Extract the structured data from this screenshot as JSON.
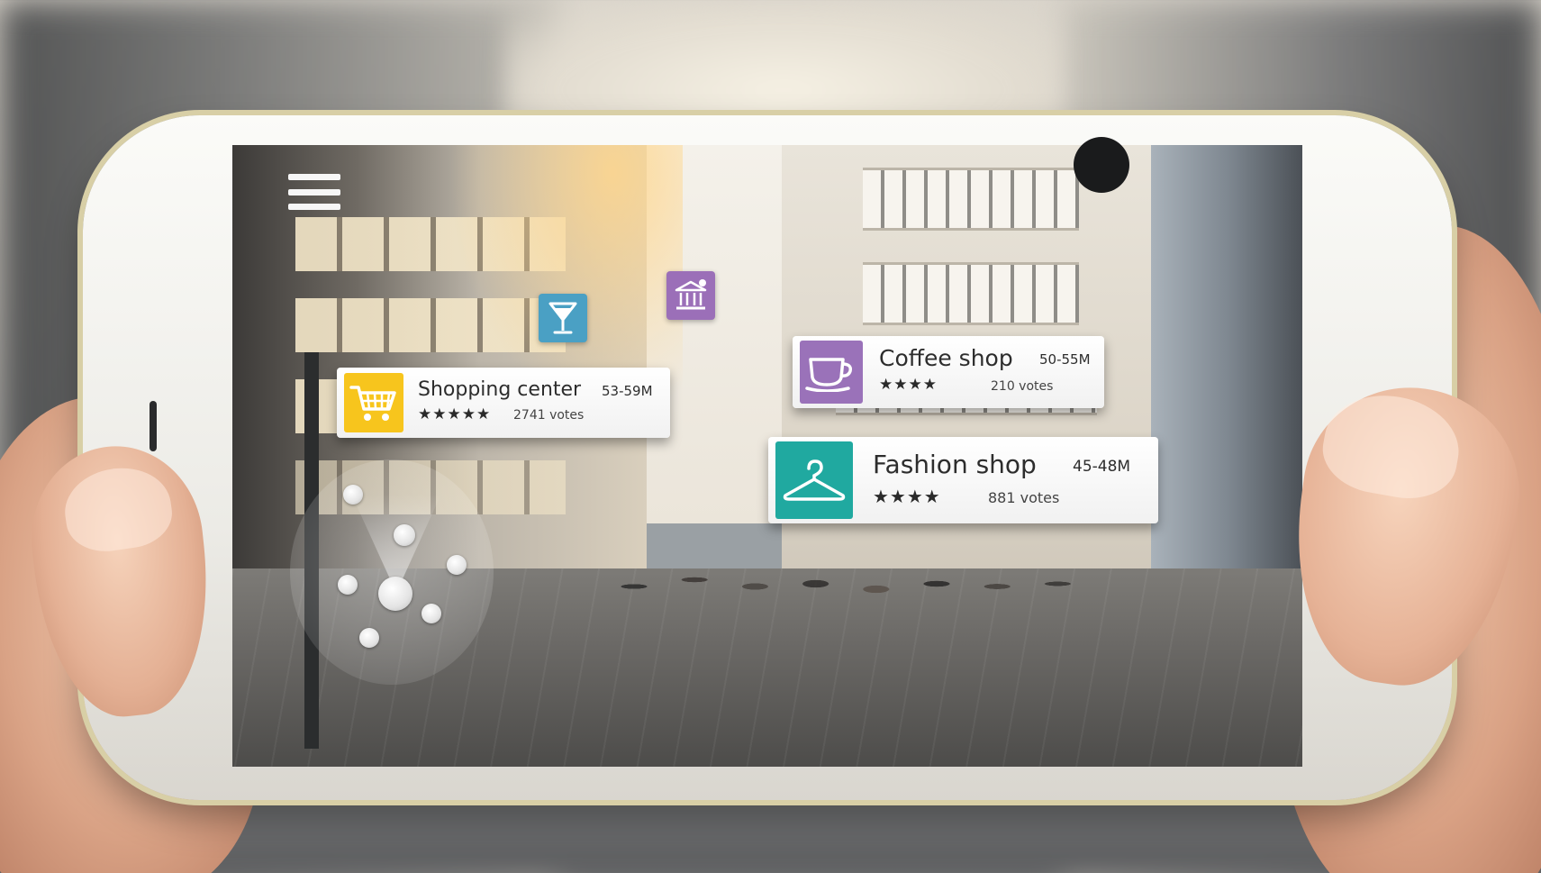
{
  "menu": {
    "icon": "hamburger-menu-icon"
  },
  "floating_icons": [
    {
      "id": "bar",
      "icon": "cocktail-glass-icon",
      "color": "#4aa0c4"
    },
    {
      "id": "bank",
      "icon": "bank-icon",
      "color": "#9b6fb8"
    }
  ],
  "cards": {
    "shopping": {
      "icon": "shopping-cart-icon",
      "color": "#f7c51d",
      "title": "Shopping center",
      "distance": "53-59M",
      "stars": "★★★★★",
      "rating": 5,
      "votes": "2741 votes"
    },
    "coffee": {
      "icon": "coffee-cup-icon",
      "color": "#9a72b9",
      "title": "Coffee shop",
      "distance": "50-55M",
      "stars": "★★★★",
      "rating": 4,
      "votes": "210 votes"
    },
    "fashion": {
      "icon": "clothes-hanger-icon",
      "color": "#20a9a0",
      "title": "Fashion  shop",
      "distance": "45-48M",
      "stars": "★★★★",
      "rating": 4,
      "votes": "881 votes"
    }
  }
}
